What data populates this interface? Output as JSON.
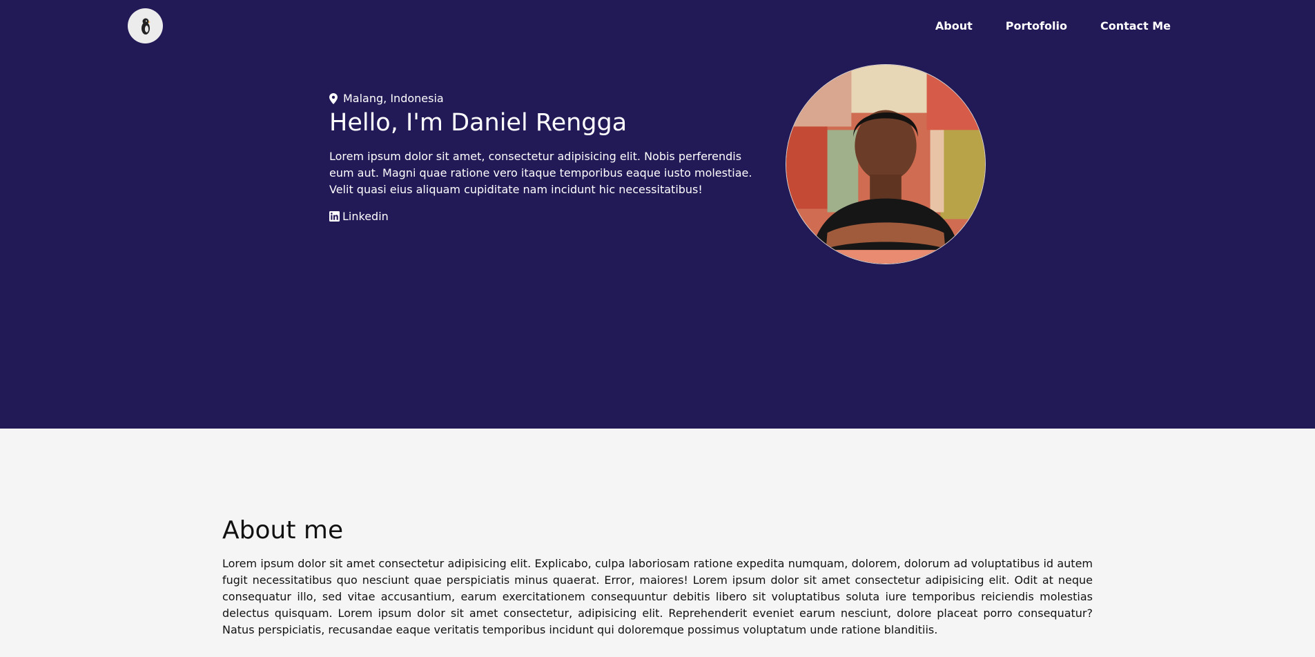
{
  "header": {
    "logo_icon": "penguin-icon",
    "nav": [
      {
        "label": "About"
      },
      {
        "label": "Portofolio"
      },
      {
        "label": "Contact Me"
      }
    ]
  },
  "hero": {
    "location_icon": "map-pin-icon",
    "location": "Malang, Indonesia",
    "title": "Hello, I'm Daniel Rengga",
    "text": "Lorem ipsum dolor sit amet, consectetur adipisicing elit. Nobis perferendis eum aut. Magni quae ratione vero itaque temporibus eaque iusto molestiae. Velit quasi eius aliquam cupiditate nam incidunt hic necessitatibus!",
    "linkedin_icon": "linkedin-icon",
    "linkedin_label": "Linkedin"
  },
  "about": {
    "title": "About me",
    "text": "Lorem ipsum dolor sit amet consectetur adipisicing elit. Explicabo, culpa laboriosam ratione expedita numquam, dolorem, dolorum ad voluptatibus id autem fugit necessitatibus quo nesciunt quae perspiciatis minus quaerat. Error, maiores! Lorem ipsum dolor sit amet consectetur adipisicing elit. Odit at neque consequatur illo, sed vitae accusantium, earum exercitationem consequuntur debitis libero sit voluptatibus soluta iure temporibus reiciendis molestias delectus quisquam. Lorem ipsum dolor sit amet consectetur, adipisicing elit. Reprehenderit eveniet earum nesciunt, dolore placeat porro consequatur? Natus perspiciatis, recusandae eaque veritatis temporibus incidunt qui doloremque possimus voluptatum unde ratione blanditiis."
  },
  "colors": {
    "hero_bg": "#221957",
    "page_bg": "#f5f5f5",
    "text_light": "#ffffff",
    "text_dark": "#111111"
  }
}
